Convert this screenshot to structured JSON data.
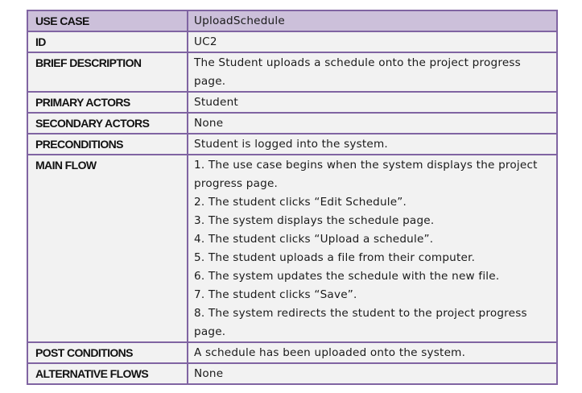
{
  "use_case": {
    "rows": [
      {
        "label": "USE CASE",
        "value": "UploadSchedule"
      },
      {
        "label": "ID",
        "value": "UC2"
      },
      {
        "label": "BRIEF DESCRIPTION",
        "value": "The Student uploads a schedule onto the project progress page."
      },
      {
        "label": "PRIMARY ACTORS",
        "value": "Student"
      },
      {
        "label": "SECONDARY ACTORS",
        "value": "None"
      },
      {
        "label": "PRECONDITIONS",
        "value": "Student is logged into the system."
      },
      {
        "label": "MAIN FLOW",
        "steps": [
          "1. The use case begins when the system displays the project progress page.",
          "2. The student clicks “Edit Schedule”.",
          "3. The system displays the schedule page.",
          "4. The student clicks “Upload a schedule”.",
          "5. The student uploads a file from their computer.",
          "6. The system updates the schedule with the new file.",
          "7. The student clicks “Save”.",
          "8. The system redirects the student to the project progress page."
        ]
      },
      {
        "label": "POST CONDITIONS",
        "value": "A schedule has been uploaded onto the system."
      },
      {
        "label": "ALTERNATIVE FLOWS",
        "value": "None"
      }
    ]
  },
  "colors": {
    "border": "#8064a2",
    "header_fill": "#ccc0da",
    "row_fill": "#f2f2f2"
  }
}
